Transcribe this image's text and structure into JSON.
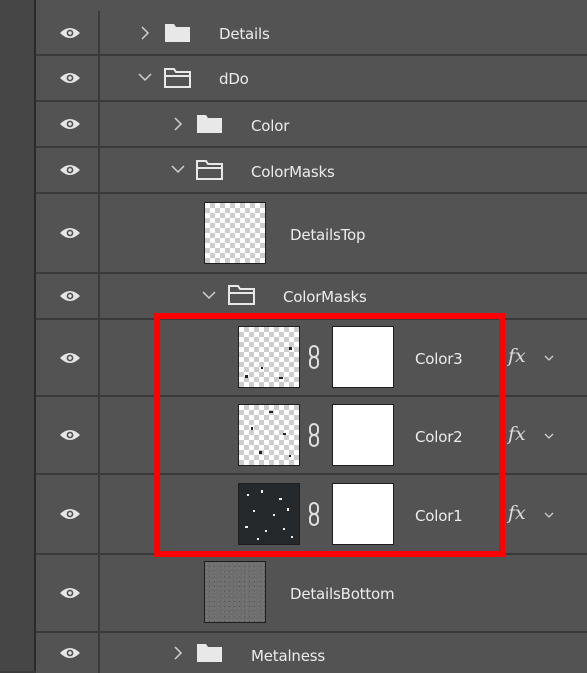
{
  "layers": [
    {
      "name": "Details"
    },
    {
      "name": "dDo"
    },
    {
      "name": "Color"
    },
    {
      "name": "ColorMasks"
    },
    {
      "name": "DetailsTop"
    },
    {
      "name": "ColorMasks"
    },
    {
      "name": "Color3",
      "fx": "fx"
    },
    {
      "name": "Color2",
      "fx": "fx"
    },
    {
      "name": "Color1",
      "fx": "fx"
    },
    {
      "name": "DetailsBottom"
    },
    {
      "name": "Metalness"
    }
  ],
  "colors": {
    "panel_bg": "#535353",
    "row_divider": "#3a3a3a",
    "highlight_border": "#ff0000",
    "text": "#ececec"
  }
}
